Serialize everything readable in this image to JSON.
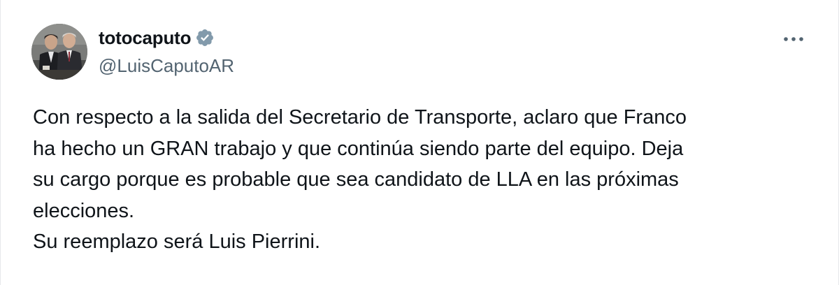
{
  "author": {
    "display_name": "totocaputo",
    "handle": "@LuisCaputoAR",
    "verified": true,
    "verified_color": "#829aab"
  },
  "menu": {
    "icon": "more-horizontal-icon"
  },
  "tweet": {
    "lines": [
      "Con respecto a la salida del Secretario de Transporte, aclaro que Franco",
      "ha hecho un GRAN trabajo y que continúa siendo parte del equipo. Deja",
      "su cargo porque es probable que sea candidato de LLA en las próximas",
      "elecciones.",
      "Su reemplazo será Luis Pierrini."
    ]
  }
}
